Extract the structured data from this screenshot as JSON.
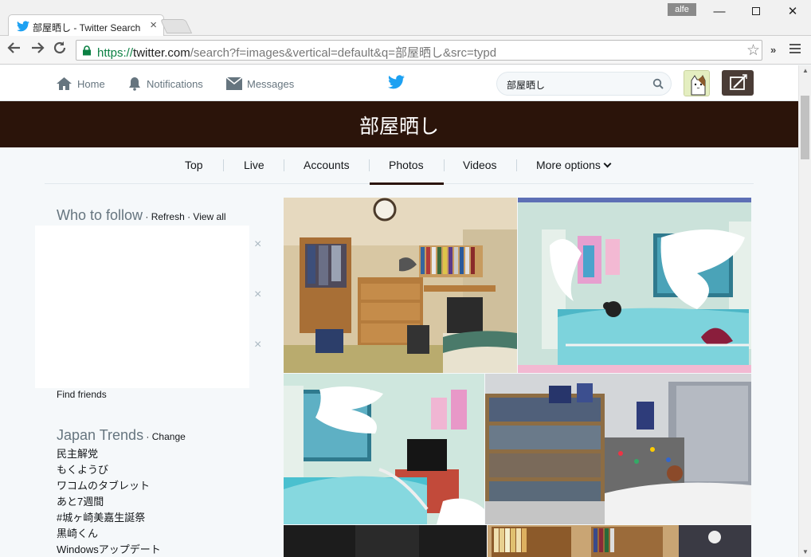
{
  "browser": {
    "tab_title": "部屋晒し - Twitter Search",
    "profile_name": "alfe",
    "url_scheme": "https://",
    "url_host": "twitter.com",
    "url_path": "/search?f=images&vertical=default&q=部屋晒し&src=typd"
  },
  "topnav": {
    "home_label": "Home",
    "notifications_label": "Notifications",
    "messages_label": "Messages",
    "search_value": "部屋晒し"
  },
  "hero": {
    "title": "部屋晒し"
  },
  "search_tabs": {
    "top": "Top",
    "live": "Live",
    "accounts": "Accounts",
    "photos": "Photos",
    "videos": "Videos",
    "more": "More options",
    "selected": "Photos"
  },
  "who_to_follow": {
    "title": "Who to follow",
    "sep1": " · ",
    "refresh": "Refresh",
    "sep2": " · ",
    "view_all": "View all",
    "dismiss_glyph": "×",
    "find_friends": "Find friends"
  },
  "trends": {
    "title": "Japan Trends",
    "sep": " · ",
    "change": "Change",
    "items": [
      "民主解党",
      "もくようび",
      "ワコムのタブレット",
      "あと7週間",
      "#城ヶ崎美嘉生誕祭",
      "黒崎くん",
      "Windowsアップデート"
    ]
  },
  "colors": {
    "hero_bg": "#2b140a",
    "twitter_blue": "#1da1f2",
    "secure_green": "#0b8043"
  }
}
